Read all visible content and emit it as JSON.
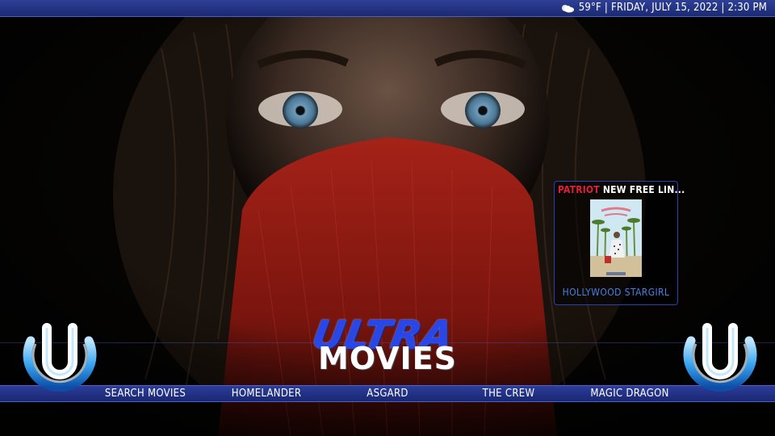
{
  "status_bar": {
    "weather_icon": "partly-cloudy-icon",
    "text": "59°F | FRIDAY, JULY 15, 2022 | 2:30 PM"
  },
  "widget": {
    "brand": "PATRIOT",
    "title": "NEW FREE LIN...",
    "poster_caption": "HOLLYWOOD STARGIRL"
  },
  "logo": {
    "top": "ULTRA",
    "bottom": "MOVIES"
  },
  "menu": {
    "items": [
      {
        "label": "SEARCH MOVIES"
      },
      {
        "label": "HOMELANDER"
      },
      {
        "label": "ASGARD"
      },
      {
        "label": "THE CREW"
      },
      {
        "label": "MAGIC DRAGON"
      }
    ]
  },
  "colors": {
    "bar_blue": "#22308a",
    "accent_red": "#e0203a",
    "caption_blue": "#4a7fe4",
    "logo_blue": "#2946e6"
  }
}
